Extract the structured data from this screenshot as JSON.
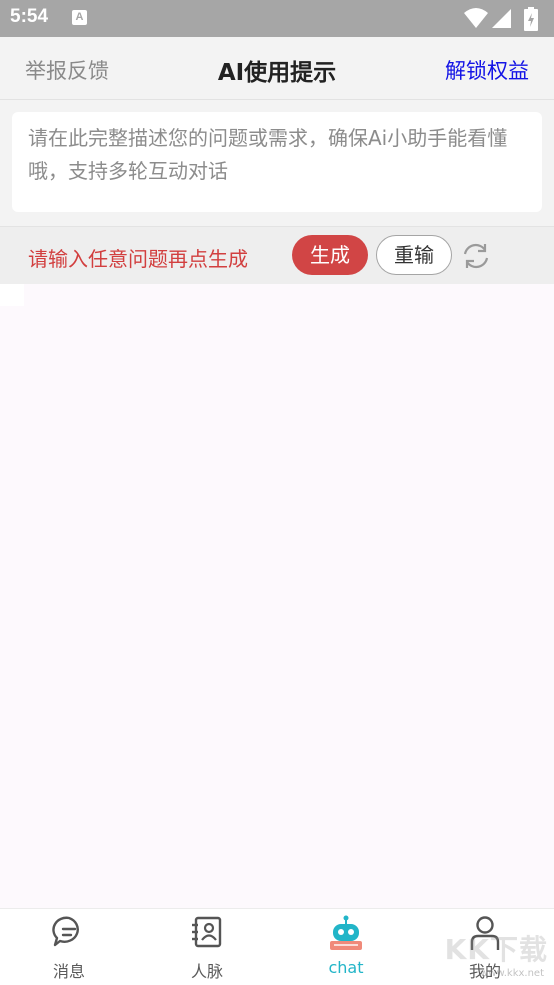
{
  "status_bar": {
    "time": "5:54",
    "notification_icon": "A",
    "icons": [
      "wifi-icon",
      "signal-icon",
      "battery-icon"
    ]
  },
  "header": {
    "left": "举报反馈",
    "title": "AI使用提示",
    "right": "解锁权益"
  },
  "question": {
    "placeholder": "请在此完整描述您的问题或需求，确保Ai小助手能看懂哦，支持多轮互动对话",
    "value": ""
  },
  "actions": {
    "hint": "请输入任意问题再点生成",
    "generate": "生成",
    "reenter": "重输",
    "refresh_icon": "refresh-icon"
  },
  "nav": {
    "items": [
      {
        "label": "消息",
        "icon": "message-icon"
      },
      {
        "label": "人脉",
        "icon": "contacts-icon"
      },
      {
        "label": "chat",
        "icon": "robot-icon",
        "active": true
      },
      {
        "label": "我的",
        "icon": "profile-icon"
      }
    ]
  },
  "watermark": {
    "text": "KK下载",
    "sub": "www.kkx.net"
  },
  "colors": {
    "accent_red": "#d14545",
    "link_blue": "#1414e6",
    "active_teal": "#22b5c8",
    "content_bg": "#fdf9fd"
  }
}
